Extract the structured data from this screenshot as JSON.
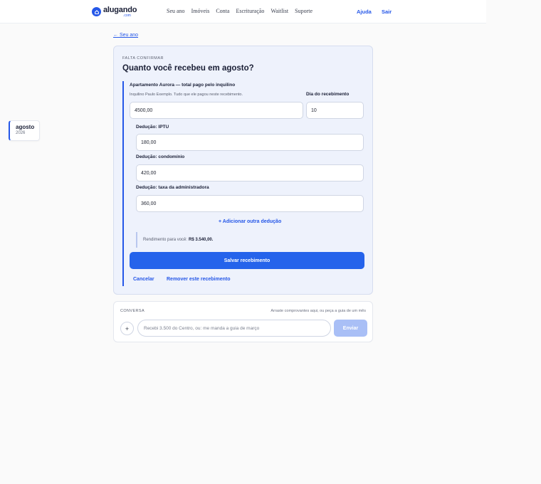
{
  "header": {
    "logo_name": "alugando",
    "logo_sub": ".com",
    "nav": [
      "Seu ano",
      "Imóveis",
      "Conta",
      "Escrituração",
      "Waitlist",
      "Suporte"
    ],
    "help_label": "Ajuda",
    "logout_label": "Sair"
  },
  "sidebar": {
    "month": "agosto",
    "year": "2026"
  },
  "back_link": "← Seu ano",
  "card": {
    "eyebrow": "FALTA CONFIRMAR",
    "title": "Quanto você recebeu em agosto?",
    "section_label": "Apartamento Aurora — total pago pelo inquilino",
    "section_help": "Inquilino Paulo Exemplo. Tudo que ele pagou neste recebimento.",
    "total_value": "4500,00",
    "day_label": "Dia do recebimento",
    "day_value": "10",
    "deductions": [
      {
        "label": "Dedução: IPTU",
        "value": "180,00"
      },
      {
        "label": "Dedução: condomínio",
        "value": "420,00"
      },
      {
        "label": "Dedução: taxa da administradora",
        "value": "360,00"
      }
    ],
    "add_deduction": "+ Adicionar outra dedução",
    "summary_label": "Rendimento para você:",
    "summary_value": "R$ 3.540,00.",
    "save_button": "Salvar recebimento",
    "cancel": "Cancelar",
    "remove": "Remover este recebimento"
  },
  "chat": {
    "label": "CONVERSA",
    "hint": "Arraste comprovantes aqui, ou peça a guia de um mês",
    "plus": "+",
    "placeholder": "Recebi 3.500 do Centro, ou: me manda a guia de março",
    "send": "Enviar"
  },
  "colors": {
    "accent": "#2557e8",
    "primary_button": "#2563eb",
    "card_bg": "#eef2fc",
    "send_disabled": "#a9bff6"
  }
}
